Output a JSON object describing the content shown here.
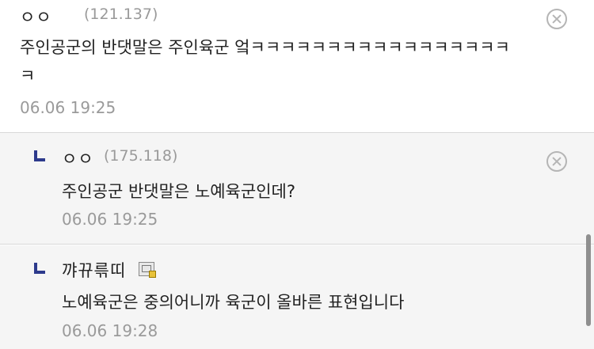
{
  "comments": [
    {
      "nickname": "ㅇㅇ",
      "ip": "(121.137)",
      "body_line1": "주인공군의 반댓말은 주인육군 엌ㅋㅋㅋㅋㅋㅋㅋㅋㅋㅋㅋㅋㅋㅋㅋㅋㅋ",
      "body_line2": "ㅋ",
      "timestamp": "06.06 19:25",
      "is_reply": false
    },
    {
      "nickname": "ㅇㅇ",
      "ip": "(175.118)",
      "body": "주인공군 반댓말은 노예육군인데?",
      "timestamp": "06.06 19:25",
      "is_reply": true
    },
    {
      "nickname": "꺄뀨륶띠",
      "body": "노예육군은 중의어니까 육군이 올바른 표현입니다",
      "timestamp": "06.06 19:28",
      "is_reply": true
    }
  ],
  "icons": {
    "delete": "delete-circle-x-icon",
    "reply": "reply-arrow-icon",
    "member": "fixed-member-icon"
  },
  "colors": {
    "reply_icon": "#2d3a8c",
    "meta_text": "#9a9a9a",
    "reply_background": "#f5f5f5"
  }
}
